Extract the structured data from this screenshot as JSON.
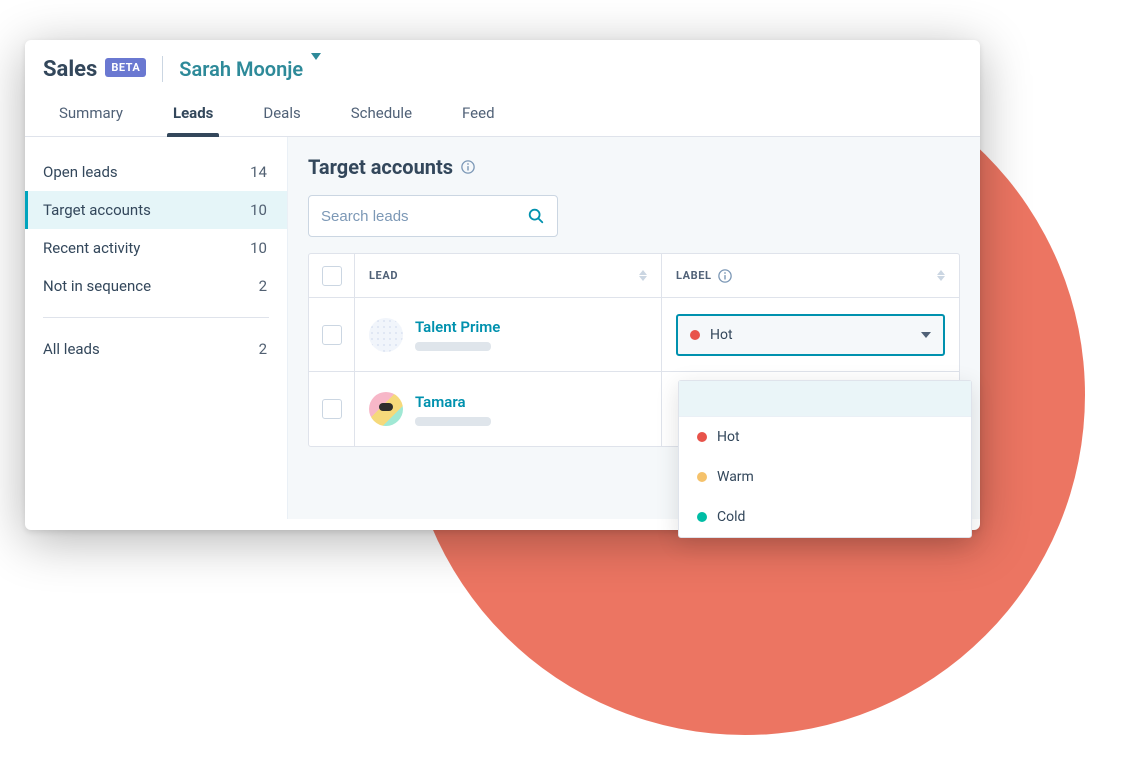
{
  "header": {
    "app": "Sales",
    "badge": "BETA",
    "user": "Sarah Moonje"
  },
  "tabs": [
    {
      "label": "Summary",
      "active": false
    },
    {
      "label": "Leads",
      "active": true
    },
    {
      "label": "Deals",
      "active": false
    },
    {
      "label": "Schedule",
      "active": false
    },
    {
      "label": "Feed",
      "active": false
    }
  ],
  "sidebar": {
    "items": [
      {
        "label": "Open leads",
        "count": "14",
        "active": false
      },
      {
        "label": "Target accounts",
        "count": "10",
        "active": true
      },
      {
        "label": "Recent activity",
        "count": "10",
        "active": false
      },
      {
        "label": "Not in sequence",
        "count": "2",
        "active": false
      }
    ],
    "all": {
      "label": "All leads",
      "count": "2"
    }
  },
  "main": {
    "title": "Target accounts",
    "search_placeholder": "Search leads",
    "columns": {
      "lead": "LEAD",
      "label": "LABEL"
    },
    "rows": [
      {
        "name": "Talent Prime"
      },
      {
        "name": "Tamara"
      }
    ],
    "selected_label": "Hot",
    "label_options": [
      {
        "name": "Hot",
        "cls": "hot"
      },
      {
        "name": "Warm",
        "cls": "warm"
      },
      {
        "name": "Cold",
        "cls": "cold"
      }
    ]
  }
}
